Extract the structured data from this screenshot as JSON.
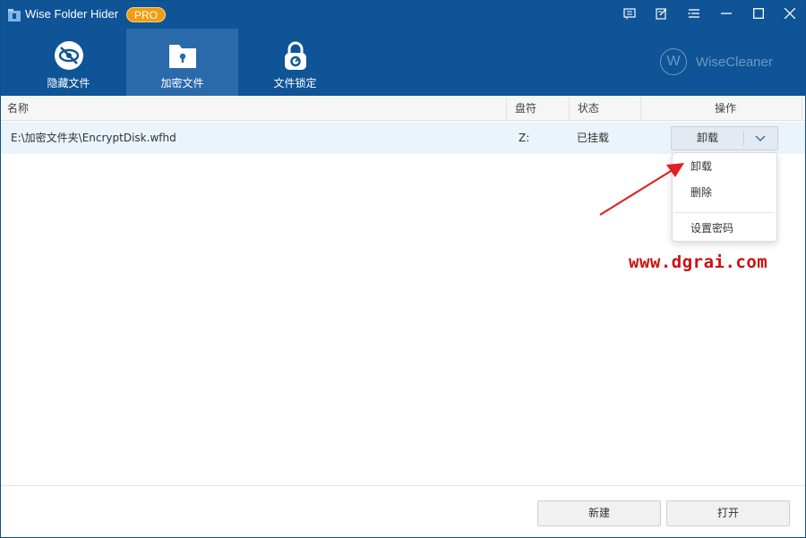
{
  "window": {
    "title": "Wise Folder Hider",
    "badge": "PRO",
    "controls": [
      "feedback-icon",
      "edit-icon",
      "menu-icon",
      "minimize-icon",
      "maximize-icon",
      "close-icon"
    ]
  },
  "tabs": [
    {
      "label": "隐藏文件",
      "icon": "eye-hidden-icon",
      "active": false
    },
    {
      "label": "加密文件",
      "icon": "locked-folder-icon",
      "active": true
    },
    {
      "label": "文件锁定",
      "icon": "lock-icon",
      "active": false
    }
  ],
  "brand": {
    "initial": "W",
    "name": "WiseCleaner"
  },
  "table": {
    "columns": [
      "名称",
      "盘符",
      "状态",
      "操作"
    ],
    "rows": [
      {
        "name": "E:\\加密文件夹\\EncryptDisk.wfhd",
        "drive": "Z:",
        "status": "已挂载",
        "action": "卸载"
      }
    ]
  },
  "dropdown": {
    "items": [
      "卸载",
      "删除",
      "设置密码"
    ]
  },
  "watermark": "www.dgrai.com",
  "footer": {
    "new_label": "新建",
    "open_label": "打开"
  },
  "colors": {
    "header_bg": "#0e5496",
    "active_tab_bg": "#2a6aab",
    "pro_badge": "#f39c12",
    "row_selected": "#eaf4fc",
    "watermark": "#cc1111"
  }
}
